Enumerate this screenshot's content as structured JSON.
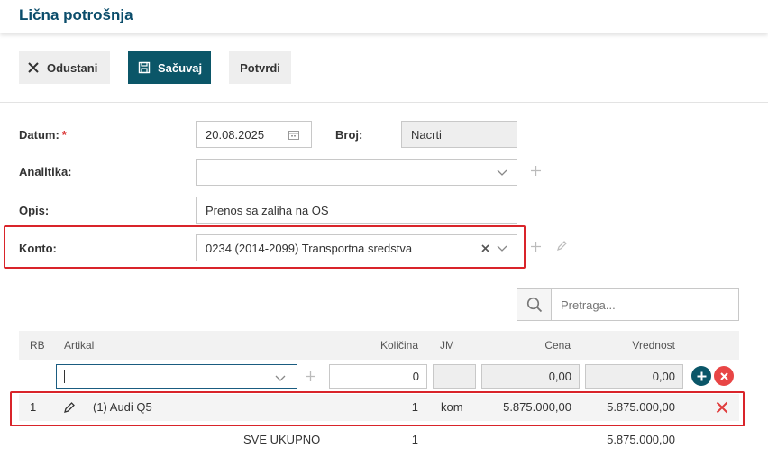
{
  "header": {
    "title": "Lična potrošnja"
  },
  "toolbar": {
    "cancel_label": "Odustani",
    "save_label": "Sačuvaj",
    "confirm_label": "Potvrdi"
  },
  "form": {
    "datum_label": "Datum:",
    "required_mark": "*",
    "datum_value": "20.08.2025",
    "broj_label": "Broj:",
    "broj_value": "Nacrti",
    "analitika_label": "Analitika:",
    "analitika_value": "",
    "opis_label": "Opis:",
    "opis_value": "Prenos sa zaliha na OS",
    "konto_label": "Konto:",
    "konto_value": "0234 (2014-2099) Transportna sredstva"
  },
  "search": {
    "placeholder": "Pretraga..."
  },
  "table": {
    "headers": {
      "rb": "RB",
      "artikal": "Artikal",
      "kolicina": "Količina",
      "jm": "JM",
      "cena": "Cena",
      "vrednost": "Vrednost"
    },
    "entry": {
      "kolicina": "0",
      "jm": "",
      "cena": "0,00",
      "vrednost": "0,00"
    },
    "rows": [
      {
        "rb": "1",
        "artikal": "(1) Audi Q5",
        "kolicina": "1",
        "jm": "kom",
        "cena": "5.875.000,00",
        "vrednost": "5.875.000,00"
      }
    ],
    "total": {
      "label": "SVE UKUPNO",
      "kolicina": "1",
      "vrednost": "5.875.000,00"
    }
  },
  "colors": {
    "primary": "#0b5668",
    "title": "#0b4d6b",
    "highlight": "#d9242a",
    "danger": "#e84545"
  }
}
